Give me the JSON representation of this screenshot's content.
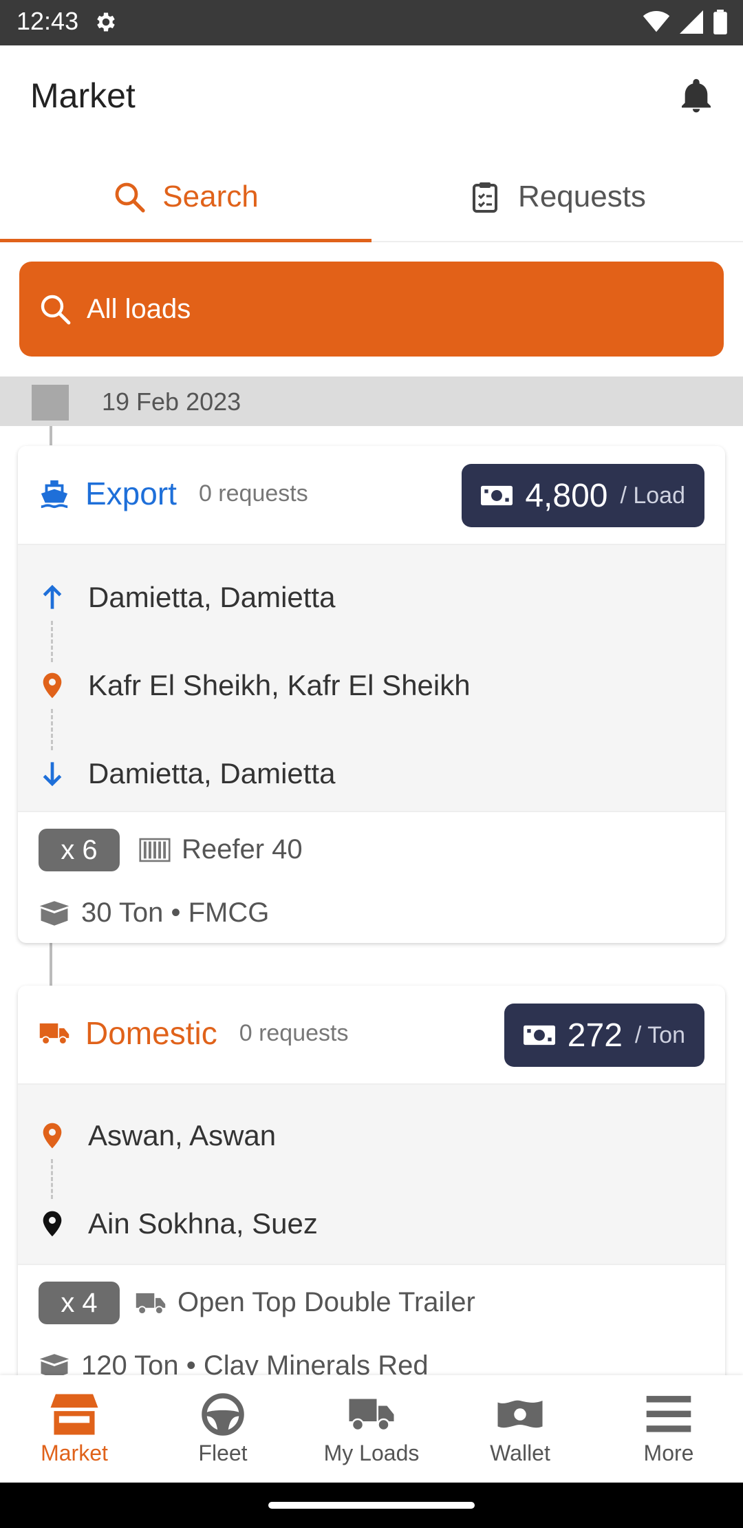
{
  "status_bar": {
    "time": "12:43"
  },
  "app_bar": {
    "title": "Market"
  },
  "tabs": [
    {
      "label": "Search",
      "icon": "search-icon",
      "active": true
    },
    {
      "label": "Requests",
      "icon": "clipboard-icon",
      "active": false
    }
  ],
  "search": {
    "label": "All loads"
  },
  "date": "19 Feb 2023",
  "cards": [
    {
      "type": "Export",
      "type_icon": "ship-icon",
      "type_color": "#1e6fd9",
      "requests": "0 requests",
      "price": "4,800",
      "price_unit": "/ Load",
      "stops": [
        "Damietta, Damietta",
        "Kafr El Sheikh, Kafr El Sheikh",
        "Damietta, Damietta"
      ],
      "quantity": "x 6",
      "container": "Reefer 40",
      "weight_line": "30 Ton • FMCG"
    },
    {
      "type": "Domestic",
      "type_icon": "truck-icon",
      "type_color": "#e0621a",
      "requests": "0 requests",
      "price": "272",
      "price_unit": "/ Ton",
      "stops": [
        "Aswan, Aswan",
        "Ain Sokhna, Suez"
      ],
      "quantity": "x 4",
      "container": "Open Top Double Trailer",
      "weight_line": "120 Ton • Clay Minerals Red"
    }
  ],
  "bottom_nav": [
    {
      "label": "Market",
      "icon": "store-icon",
      "active": true
    },
    {
      "label": "Fleet",
      "icon": "steering-wheel-icon",
      "active": false
    },
    {
      "label": "My Loads",
      "icon": "truck-icon",
      "active": false
    },
    {
      "label": "Wallet",
      "icon": "money-icon",
      "active": false
    },
    {
      "label": "More",
      "icon": "menu-icon",
      "active": false
    }
  ],
  "colors": {
    "accent": "#e0621a",
    "price_bg": "#2d3350",
    "export_blue": "#1e6fd9"
  }
}
